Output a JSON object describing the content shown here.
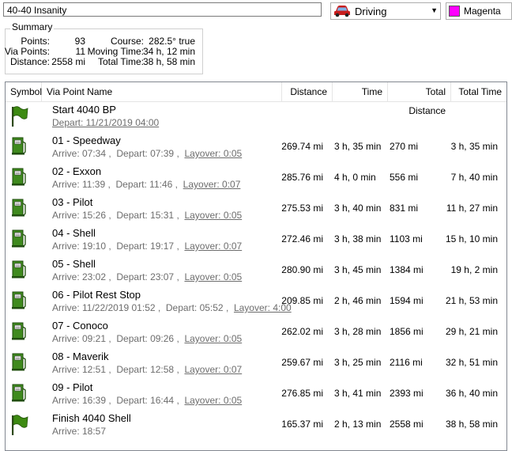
{
  "route_name": "40-40 Insanity",
  "mode": {
    "label": "Driving",
    "icon": "car-icon"
  },
  "color": {
    "label": "Magenta",
    "value": "#ff00ff"
  },
  "summary": {
    "title": "Summary",
    "points_label": "Points:",
    "points": "93",
    "via_label": "Via Points:",
    "via": "11",
    "distance_label": "Distance:",
    "distance": "2558 mi",
    "course_label": "Course:",
    "course": "282.5° true",
    "moving_label": "Moving Time:",
    "moving": "34 h, 12 min",
    "total_label": "Total Time:",
    "total": "38 h, 58 min"
  },
  "columns": [
    "Symbol",
    "Via Point Name",
    "Distance",
    "Time",
    "Total Distance",
    "Total Time"
  ],
  "rows": [
    {
      "symbol": "flag-icon",
      "name": "Start 4040 BP",
      "depart": "Depart: 11/21/2019 04:00"
    },
    {
      "symbol": "gas-station-icon",
      "name": "01 - Speedway",
      "arrive": "Arrive: 07:34",
      "depart": "Depart: 07:39",
      "layover": "Layover: 0:05",
      "distance": "269.74 mi",
      "time": "3 h, 35 min",
      "total_distance": "270 mi",
      "total_time": "3 h, 35 min"
    },
    {
      "symbol": "gas-station-icon",
      "name": "02 - Exxon",
      "arrive": "Arrive: 11:39",
      "depart": "Depart: 11:46",
      "layover": "Layover: 0:07",
      "distance": "285.76 mi",
      "time": "4 h, 0 min",
      "total_distance": "556 mi",
      "total_time": "7 h, 40 min"
    },
    {
      "symbol": "gas-station-icon",
      "name": "03 - Pilot",
      "arrive": "Arrive: 15:26",
      "depart": "Depart: 15:31",
      "layover": "Layover: 0:05",
      "distance": "275.53 mi",
      "time": "3 h, 40 min",
      "total_distance": "831 mi",
      "total_time": "11 h, 27 min"
    },
    {
      "symbol": "gas-station-icon",
      "name": "04 - Shell",
      "arrive": "Arrive: 19:10",
      "depart": "Depart: 19:17",
      "layover": "Layover: 0:07",
      "distance": "272.46 mi",
      "time": "3 h, 38 min",
      "total_distance": "1103 mi",
      "total_time": "15 h, 10 min"
    },
    {
      "symbol": "gas-station-icon",
      "name": "05 - Shell",
      "arrive": "Arrive: 23:02",
      "depart": "Depart: 23:07",
      "layover": "Layover: 0:05",
      "distance": "280.90 mi",
      "time": "3 h, 45 min",
      "total_distance": "1384 mi",
      "total_time": "19 h, 2 min"
    },
    {
      "symbol": "gas-station-icon",
      "name": "06 - Pilot Rest Stop",
      "arrive": "Arrive: 11/22/2019 01:52",
      "depart": "Depart: 05:52",
      "layover": "Layover: 4:00",
      "distance": "209.85 mi",
      "time": "2 h, 46 min",
      "total_distance": "1594 mi",
      "total_time": "21 h, 53 min"
    },
    {
      "symbol": "gas-station-icon",
      "name": "07 - Conoco",
      "arrive": "Arrive: 09:21",
      "depart": "Depart: 09:26",
      "layover": "Layover: 0:05",
      "distance": "262.02 mi",
      "time": "3 h, 28 min",
      "total_distance": "1856 mi",
      "total_time": "29 h, 21 min"
    },
    {
      "symbol": "gas-station-icon",
      "name": "08 - Maverik",
      "arrive": "Arrive: 12:51",
      "depart": "Depart: 12:58",
      "layover": "Layover: 0:07",
      "distance": "259.67 mi",
      "time": "3 h, 25 min",
      "total_distance": "2116 mi",
      "total_time": "32 h, 51 min"
    },
    {
      "symbol": "gas-station-icon",
      "name": "09 - Pilot",
      "arrive": "Arrive: 16:39",
      "depart": "Depart: 16:44",
      "layover": "Layover: 0:05",
      "distance": "276.85 mi",
      "time": "3 h, 41 min",
      "total_distance": "2393 mi",
      "total_time": "36 h, 40 min"
    },
    {
      "symbol": "flag-icon",
      "name": "Finish 4040 Shell",
      "arrive": "Arrive: 18:57",
      "distance": "165.37 mi",
      "time": "2 h, 13 min",
      "total_distance": "2558 mi",
      "total_time": "38 h, 58 min"
    }
  ]
}
